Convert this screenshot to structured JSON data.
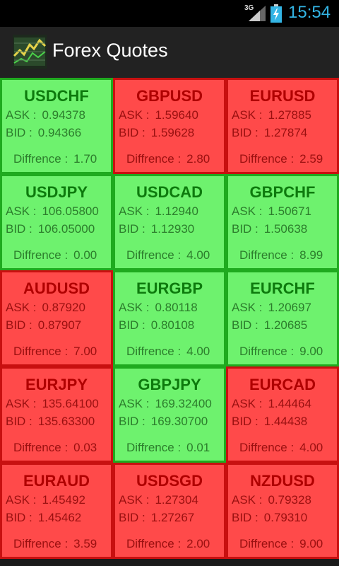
{
  "status_bar": {
    "network": "3G",
    "time": "15:54",
    "icons": [
      "signal-icon",
      "battery-charging-icon"
    ]
  },
  "app": {
    "title": "Forex Quotes",
    "icon": "app-logo-icon"
  },
  "labels": {
    "ask": "ASK :",
    "bid": "BID :",
    "difference": "Diffrence :"
  },
  "colors": {
    "up_bg": "#6ef26e",
    "up_border": "#1faa1f",
    "down_bg": "#ff4a4a",
    "down_border": "#c81010",
    "clock": "#33b5e5"
  },
  "quotes": [
    {
      "pair": "USDCHF",
      "ask": "0.94378",
      "bid": "0.94366",
      "diff": "1.70",
      "trend": "up"
    },
    {
      "pair": "GBPUSD",
      "ask": "1.59640",
      "bid": "1.59628",
      "diff": "2.80",
      "trend": "down"
    },
    {
      "pair": "EURUSD",
      "ask": "1.27885",
      "bid": "1.27874",
      "diff": "2.59",
      "trend": "down"
    },
    {
      "pair": "USDJPY",
      "ask": "106.05800",
      "bid": "106.05000",
      "diff": "0.00",
      "trend": "up"
    },
    {
      "pair": "USDCAD",
      "ask": "1.12940",
      "bid": "1.12930",
      "diff": "4.00",
      "trend": "up"
    },
    {
      "pair": "GBPCHF",
      "ask": "1.50671",
      "bid": "1.50638",
      "diff": "8.99",
      "trend": "up"
    },
    {
      "pair": "AUDUSD",
      "ask": "0.87920",
      "bid": "0.87907",
      "diff": "7.00",
      "trend": "down"
    },
    {
      "pair": "EURGBP",
      "ask": "0.80118",
      "bid": "0.80108",
      "diff": "4.00",
      "trend": "up"
    },
    {
      "pair": "EURCHF",
      "ask": "1.20697",
      "bid": "1.20685",
      "diff": "9.00",
      "trend": "up"
    },
    {
      "pair": "EURJPY",
      "ask": "135.64100",
      "bid": "135.63300",
      "diff": "0.03",
      "trend": "down"
    },
    {
      "pair": "GBPJPY",
      "ask": "169.32400",
      "bid": "169.30700",
      "diff": "0.01",
      "trend": "up"
    },
    {
      "pair": "EURCAD",
      "ask": "1.44464",
      "bid": "1.44438",
      "diff": "4.00",
      "trend": "down"
    },
    {
      "pair": "EURAUD",
      "ask": "1.45492",
      "bid": "1.45462",
      "diff": "3.59",
      "trend": "down"
    },
    {
      "pair": "USDSGD",
      "ask": "1.27304",
      "bid": "1.27267",
      "diff": "2.00",
      "trend": "down"
    },
    {
      "pair": "NZDUSD",
      "ask": "0.79328",
      "bid": "0.79310",
      "diff": "9.00",
      "trend": "down"
    }
  ]
}
